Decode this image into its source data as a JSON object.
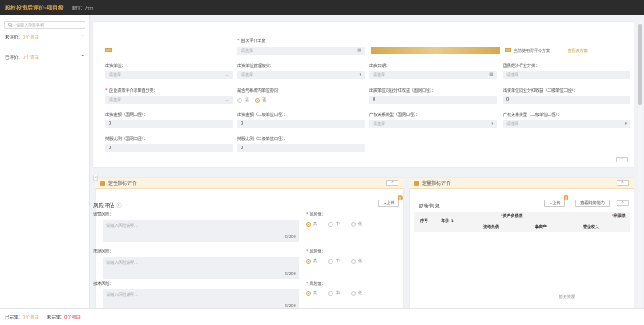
{
  "topbar": {
    "title": "股权投资后评价-项目级",
    "unit": "单位：万元"
  },
  "sidebar": {
    "search_placeholder": "请输入项目名称",
    "groups": [
      {
        "label": "未评价：",
        "count": "0个项目"
      },
      {
        "label": "已评价：",
        "count": "0个项目"
      }
    ]
  },
  "top": {
    "gold_tag_1": "",
    "eval_year_label": "首次评价年度：",
    "eval_year_placeholder": "请选择",
    "scheme_text": "当前使用得评价方案",
    "scheme_link": "查看该方案",
    "fields": [
      {
        "label": "出资单位：",
        "placeholder": "请选择",
        "icon": "..."
      },
      {
        "label": "出资单位管理级次：",
        "placeholder": "请选择",
        "icon": "▾"
      },
      {
        "label": "出资日期：",
        "placeholder": "请选择",
        "icon": "▦"
      },
      {
        "label": "国民经济行业分类：",
        "placeholder": "请选择",
        "icon": ""
      },
      {
        "label": "企业绩效评价标准值分类：",
        "placeholder": "请选择",
        "icon": "...",
        "required": true
      },
      {
        "label": "是否与系统内单位协同：",
        "radio": [
          "是",
          "否"
        ]
      },
      {
        "label": "出资单位同业分红收益（国网口径）：",
        "value": "0"
      },
      {
        "label": "出资单位同业分红收益（二级单位口径）：",
        "value": "0"
      },
      {
        "label": "出资金额（国网口径）：",
        "value": "0"
      },
      {
        "label": "出资金额（二级单位口径）：",
        "value": "0"
      },
      {
        "label": "产权关系类型（国网口径）：",
        "placeholder": "请选择",
        "icon": "▾"
      },
      {
        "label": "产权关系类型（二级单位口径）：",
        "placeholder": "请选择",
        "icon": "▾"
      },
      {
        "label": "持股比例（国网口径）：",
        "value": "0"
      },
      {
        "label": "持股比例（二级单位口径）：",
        "value": "0"
      }
    ]
  },
  "qualitative": {
    "title": "定性指标评价",
    "risk_title": "风险评估",
    "upload": "上传",
    "badge": "0",
    "risks": [
      {
        "label": "运营风险：",
        "placeholder": "请输入风险说明...",
        "count": "0/200",
        "level_label": "风险值：",
        "options": [
          "高",
          "中",
          "低"
        ]
      },
      {
        "label": "市场风险：",
        "placeholder": "请输入风险说明...",
        "count": "0/200",
        "level_label": "风险值：",
        "options": [
          "高",
          "中",
          "低"
        ]
      },
      {
        "label": "技术风险：",
        "placeholder": "请输入风险说明...",
        "count": "0/200",
        "level_label": "风险值：",
        "options": [
          "高",
          "中",
          "低"
        ]
      }
    ]
  },
  "quantitative": {
    "title": "定量指标评价",
    "fin_title": "财务信息",
    "upload": "上传",
    "badge": "0",
    "view_btn": "查看财务能力",
    "headers": {
      "seq": "序号",
      "year": "年份",
      "balance": "资产负债表",
      "profit": "利润表",
      "debt": "流动负债",
      "net": "净资产",
      "revenue": "营业收入"
    },
    "empty": "暂无数据"
  },
  "footer": {
    "done_label": "已完成：",
    "done_count": "0个项目",
    "todo_label": "未完成：",
    "todo_count": "0个项目"
  }
}
